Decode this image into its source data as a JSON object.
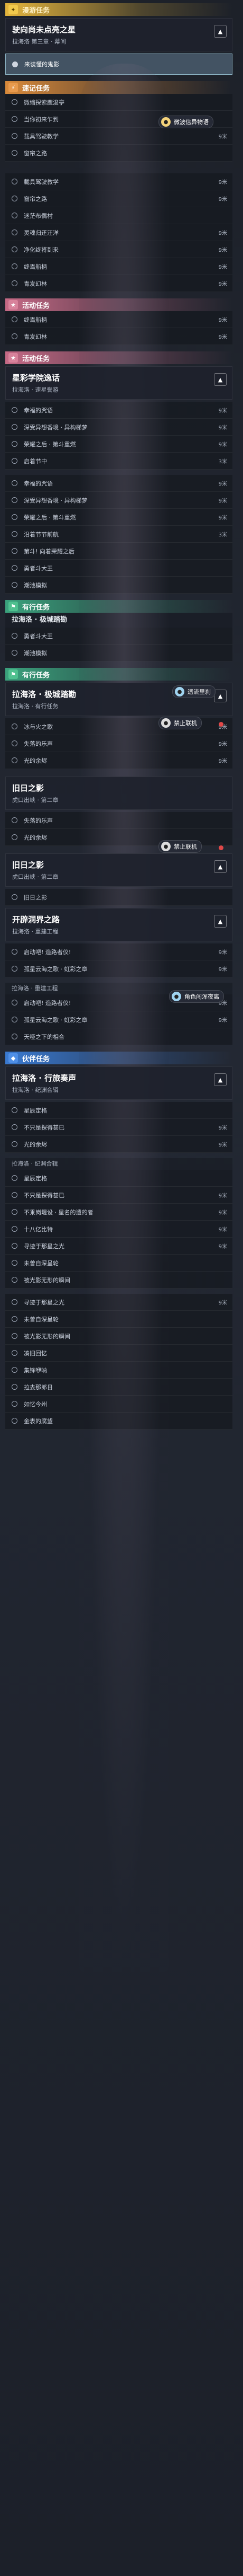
{
  "sec_trial": "漫游任务",
  "card_main": {
    "title": "驶向尚未点亮之星",
    "sub": "拉海洛 第三章 · 幕间"
  },
  "row_selected": "来装懂的鬼影",
  "sec_daily": "速记任务",
  "daily_rows": [
    {
      "label": "微缩探索鹿浚亭",
      "dist": ""
    },
    {
      "label": "当你初来乍到",
      "dist": ""
    },
    {
      "label": "载具驾驶教学",
      "dist": "9米"
    },
    {
      "label": "窗帘之路",
      "dist": ""
    }
  ],
  "daily_rows2": [
    {
      "label": "载具驾驶教学",
      "dist": "9米"
    },
    {
      "label": "窗帘之路",
      "dist": "9米"
    },
    {
      "label": "迷茫布偶村",
      "dist": ""
    },
    {
      "label": "灵魂归还汪洋",
      "dist": "9米"
    },
    {
      "label": "净化终将到来",
      "dist": "9米"
    },
    {
      "label": "终焉船柄",
      "dist": "9米"
    },
    {
      "label": "青发幻林",
      "dist": "9米"
    }
  ],
  "sec_event": "活动任务",
  "event_rows": [
    {
      "label": "终焉船柄",
      "dist": "9米"
    },
    {
      "label": "青发幻林",
      "dist": "9米"
    }
  ],
  "sec_event2": "活动任务",
  "card_event": {
    "title": "星彩学院逸话",
    "sub": "拉海洛 · 速星誉游"
  },
  "event_rows2": [
    {
      "label": "幸福的咒语",
      "dist": "9米"
    },
    {
      "label": "深受异想香境 · 异构梯梦",
      "dist": "9米"
    },
    {
      "label": "荣耀之后 · 第斗重燃",
      "dist": "9米"
    },
    {
      "label": "启着节中",
      "dist": "3米"
    }
  ],
  "event_rows3": [
    {
      "label": "幸福的咒语",
      "dist": "9米"
    },
    {
      "label": "深受异想香境 · 异构梯梦",
      "dist": "9米"
    },
    {
      "label": "荣耀之后 · 第斗重燃",
      "dist": "9米"
    },
    {
      "label": "沿着节节前航",
      "dist": "3米"
    },
    {
      "label": "第斗! 向着荣耀之后",
      "dist": ""
    },
    {
      "label": "勇者斗大王",
      "dist": ""
    },
    {
      "label": "潮池模拟",
      "dist": ""
    }
  ],
  "sec_side": "有行任务",
  "plain_a": "拉海洛 · 极城踏勘",
  "side_rows": [
    {
      "label": "勇者斗大王",
      "dist": ""
    },
    {
      "label": "潮池模拟",
      "dist": ""
    }
  ],
  "sec_side2": "有行任务",
  "card_side": {
    "title": "拉海洛 · 极城踏勘",
    "sub": "拉海洛 · 有行任务"
  },
  "side_rows2": [
    {
      "label": "冰与火之歌",
      "dist": "9米"
    },
    {
      "label": "失落的乐声",
      "dist": "9米"
    },
    {
      "label": "光的余烬",
      "dist": "9米"
    }
  ],
  "card_shadow": {
    "title": "旧日之影",
    "sub": "虎口出峡 · 第二章"
  },
  "shadow_rows": [
    {
      "label": "失落的乐声",
      "dist": ""
    },
    {
      "label": "光的余烬",
      "dist": ""
    }
  ],
  "card_shadow2": {
    "title": "旧日之影",
    "sub": "虎口出峡 · 第二章"
  },
  "shadow_rows2": [
    {
      "label": "旧日之影",
      "dist": ""
    }
  ],
  "card_open": {
    "title": "开辟洞界之路",
    "sub": "拉海洛 · 重建工程"
  },
  "open_rows": [
    {
      "label": "启动吧! 造路者仪!",
      "dist": "9米"
    },
    {
      "label": "孤星云海之歌 · 虹彩之章",
      "dist": "9米"
    }
  ],
  "plain_b": "拉海洛 · 重建工程",
  "open_rows2": [
    {
      "label": "启动吧! 造路者仪!",
      "dist": "9米"
    },
    {
      "label": "孤星云海之歌 · 虹彩之章",
      "dist": "9米"
    },
    {
      "label": "天哑之下的相合",
      "dist": ""
    }
  ],
  "sec_blue": "伙伴任务",
  "card_blue": {
    "title": "拉海洛 · 行旅奏声",
    "sub": "拉海洛 · 纪渊合辑"
  },
  "blue_rows": [
    {
      "label": "星辰定格",
      "dist": ""
    },
    {
      "label": "不只是探得甚已",
      "dist": "9米"
    },
    {
      "label": "光的余烬",
      "dist": "9米"
    }
  ],
  "plain_c": "拉海洛 · 纪渊合辑",
  "blue_rows2": [
    {
      "label": "星辰定格",
      "dist": ""
    },
    {
      "label": "不只是探得甚已",
      "dist": "9米"
    },
    {
      "label": "不乘岗堤设 · 星名的遗的者",
      "dist": "9米"
    },
    {
      "label": "十八亿比特",
      "dist": "9米"
    },
    {
      "label": "寻迹于那星之光",
      "dist": "9米"
    },
    {
      "label": "未曾自深呈轮",
      "dist": ""
    },
    {
      "label": "被光影无形的瞬间",
      "dist": ""
    }
  ],
  "blue_rows3": [
    {
      "label": "寻迹于那星之光",
      "dist": "9米"
    },
    {
      "label": "未曾自深呈轮",
      "dist": ""
    },
    {
      "label": "被光影无形的瞬间",
      "dist": ""
    },
    {
      "label": "凑旧回忆",
      "dist": ""
    },
    {
      "label": "集锋咿呐",
      "dist": ""
    },
    {
      "label": "拉去那郎日",
      "dist": ""
    },
    {
      "label": "如忆今州",
      "dist": ""
    },
    {
      "label": "金表的腐望",
      "dist": ""
    }
  ],
  "toasts": {
    "t1": "微波信异物语",
    "t2": "遗流里刹",
    "t3": "禁止联机",
    "t4": "禁止联机",
    "t5": "角色闯浑夜离"
  },
  "icons": {
    "trial": "compass-icon",
    "daily": "bolt-icon"
  }
}
